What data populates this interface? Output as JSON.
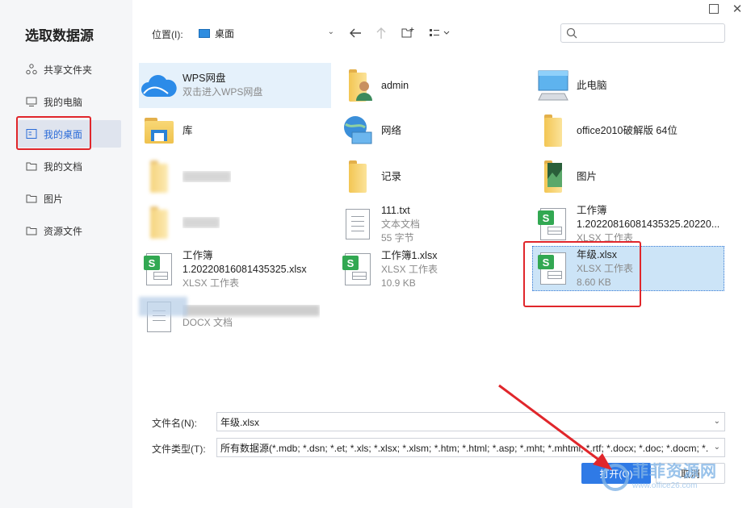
{
  "window": {
    "maximize_icon": "maximize-icon",
    "close_icon": "close-icon"
  },
  "sidebar": {
    "title": "选取数据源",
    "items": [
      {
        "label": "共享文件夹",
        "icon": "share-icon"
      },
      {
        "label": "我的电脑",
        "icon": "computer-icon"
      },
      {
        "label": "我的桌面",
        "icon": "desktop-icon",
        "active": true
      },
      {
        "label": "我的文档",
        "icon": "document-folder-icon"
      },
      {
        "label": "图片",
        "icon": "folder-icon"
      },
      {
        "label": "资源文件",
        "icon": "folder-icon"
      }
    ]
  },
  "toolbar": {
    "location_label": "位置(I):",
    "location_value": "桌面",
    "back_icon": "back-arrow-icon",
    "up_icon": "up-arrow-icon",
    "new_folder_icon": "new-folder-icon",
    "view_icon": "view-list-icon",
    "search_placeholder": ""
  },
  "files": [
    {
      "name": "WPS网盘",
      "sub1": "双击进入WPS网盘",
      "sub2": "",
      "icon": "cloud-icon"
    },
    {
      "name": "admin",
      "sub1": "",
      "sub2": "",
      "icon": "user-folder-icon"
    },
    {
      "name": "此电脑",
      "sub1": "",
      "sub2": "",
      "icon": "computer-icon"
    },
    {
      "name": "库",
      "sub1": "",
      "sub2": "",
      "icon": "library-icon"
    },
    {
      "name": "网络",
      "sub1": "",
      "sub2": "",
      "icon": "network-icon"
    },
    {
      "name": "office2010破解版 64位",
      "sub1": "",
      "sub2": "",
      "icon": "folder-icon"
    },
    {
      "name": "",
      "sub1": "",
      "sub2": "",
      "icon": "folder-icon"
    },
    {
      "name": "记录",
      "sub1": "",
      "sub2": "",
      "icon": "folder-icon"
    },
    {
      "name": "图片",
      "sub1": "",
      "sub2": "",
      "icon": "pictures-folder-icon"
    },
    {
      "name": "",
      "sub1": "",
      "sub2": "",
      "icon": "folder-icon"
    },
    {
      "name": "111.txt",
      "sub1": "文本文档",
      "sub2": "55 字节",
      "icon": "text-file-icon"
    },
    {
      "name": "工作簿",
      "sub1": "1.20220816081435325.20220...",
      "sub2": "XLSX 工作表",
      "icon": "spreadsheet-icon"
    },
    {
      "name": "工作簿",
      "sub1": "1.20220816081435325.xlsx",
      "sub2": "XLSX 工作表",
      "icon": "spreadsheet-icon"
    },
    {
      "name": "工作簿1.xlsx",
      "sub1": "XLSX 工作表",
      "sub2": "10.9 KB",
      "icon": "spreadsheet-icon"
    },
    {
      "name": "年级.xlsx",
      "sub1": "XLSX 工作表",
      "sub2": "8.60 KB",
      "icon": "spreadsheet-icon"
    },
    {
      "name": "",
      "sub1": "",
      "sub2": "DOCX 文档",
      "icon": "word-document-icon"
    }
  ],
  "form": {
    "filename_label": "文件名(N):",
    "filename_value": "年级.xlsx",
    "filetype_label": "文件类型(T):",
    "filetype_value": "所有数据源(*.mdb; *.dsn; *.et; *.xls; *.xlsx; *.xlsm; *.htm; *.html; *.asp; *.mht; *.mhtml; *.rtf; *.docx; *.doc; *.docm; *.",
    "open_label": "打开(O)",
    "cancel_label": "取消"
  },
  "watermark": {
    "line1": "菲菲资源网",
    "line2": "www.office26.com"
  },
  "colors": {
    "accent": "#2f7ae6",
    "highlight": "#e0262b",
    "excel_green": "#32a852"
  }
}
